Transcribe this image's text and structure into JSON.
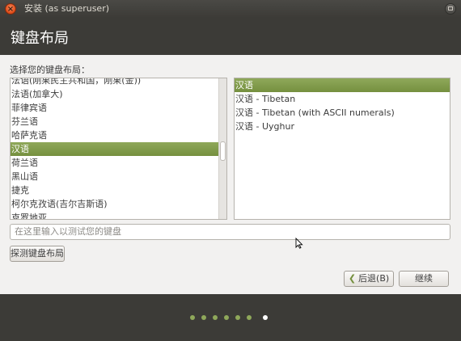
{
  "window": {
    "title": "安装 (as superuser)",
    "close_glyph": "×"
  },
  "header": {
    "title": "键盘布局"
  },
  "main": {
    "prompt": "选择您的键盘布局：",
    "layouts": [
      "法语(刚果民主共和国，刚果(金))",
      "法语(加拿大)",
      "菲律宾语",
      "芬兰语",
      "哈萨克语",
      "汉语",
      "荷兰语",
      "黑山语",
      "捷克",
      "柯尔克孜语(吉尔吉斯语)",
      "克罗地亚"
    ],
    "selected_layout_index": 5,
    "variants": [
      "汉语",
      "汉语 - Tibetan",
      "汉语 - Tibetan (with ASCII numerals)",
      "汉语 - Uyghur"
    ],
    "selected_variant_index": 0,
    "test_input_placeholder": "在这里输入以测试您的键盘",
    "detect_button": "探测键盘布局",
    "back_button": "后退(B)",
    "continue_button": "继续"
  },
  "footer": {
    "progress_steps": 7,
    "current_step": 7
  },
  "colors": {
    "accent": "#75903f",
    "header_bg": "#3c3b37",
    "window_bg": "#f2f1f0"
  }
}
